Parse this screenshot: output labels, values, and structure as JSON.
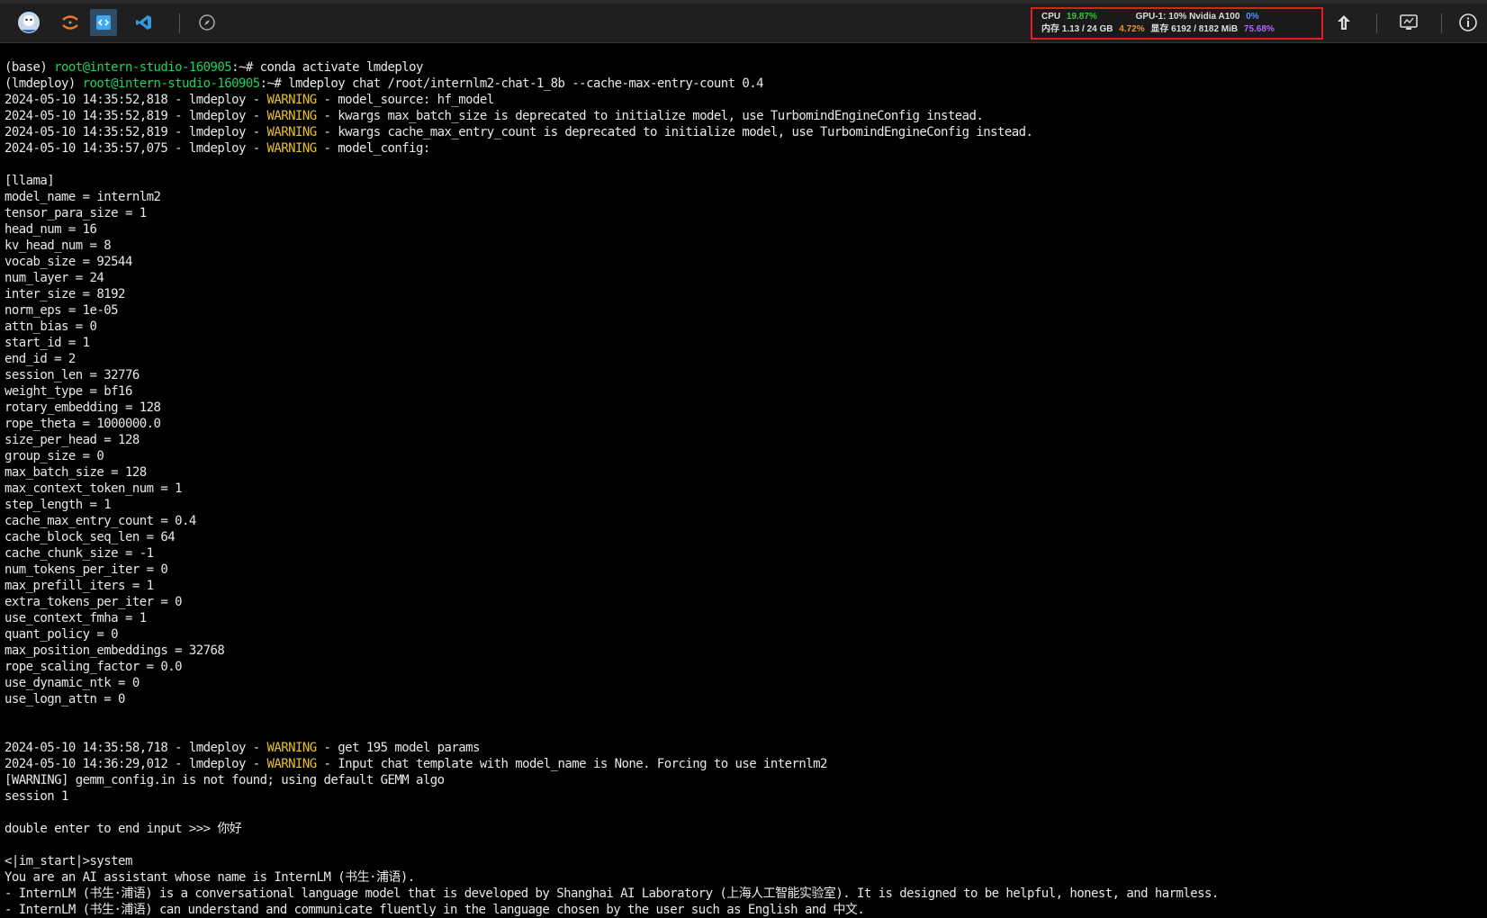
{
  "toolbar": {
    "icons": [
      "avatar-icon",
      "jupyter-icon",
      "code-editor-icon",
      "vscode-icon",
      "compass-icon",
      "upload-icon",
      "monitor-icon",
      "info-icon"
    ]
  },
  "monitor": {
    "cpu_label": "CPU",
    "cpu_value": "19.87%",
    "gpu_label": "GPU-1: 10% Nvidia A100",
    "gpu_value": "0%",
    "mem_label": "内存 1.13 / 24 GB",
    "mem_value": "4.72%",
    "vram_label": "显存 6192 / 8182 MiB",
    "vram_value": "75.68%",
    "colors": {
      "green": "#3fbf3f",
      "orange": "#e8962c",
      "blue": "#5a8cff",
      "purple": "#b067ff",
      "border": "#e0201c"
    }
  },
  "terminal": {
    "cmd1": {
      "prefix": "(base) ",
      "prompt": "root@intern-studio-160905",
      "sep": ":~# ",
      "command": "conda activate lmdeploy"
    },
    "cmd2": {
      "prefix": "(lmdeploy) ",
      "prompt": "root@intern-studio-160905",
      "sep": ":~# ",
      "command": "lmdeploy chat /root/internlm2-chat-1_8b --cache-max-entry-count 0.4"
    },
    "warn1": {
      "pre": "2024-05-10 14:35:52,818 - lmdeploy - ",
      "tag": "WARNING",
      "msg": " - model_source: hf_model"
    },
    "warn2": {
      "pre": "2024-05-10 14:35:52,819 - lmdeploy - ",
      "tag": "WARNING",
      "msg": " - kwargs max_batch_size is deprecated to initialize model, use TurbomindEngineConfig instead."
    },
    "warn3": {
      "pre": "2024-05-10 14:35:52,819 - lmdeploy - ",
      "tag": "WARNING",
      "msg": " - kwargs cache_max_entry_count is deprecated to initialize model, use TurbomindEngineConfig instead."
    },
    "warn4": {
      "pre": "2024-05-10 14:35:57,075 - lmdeploy - ",
      "tag": "WARNING",
      "msg": " - model_config:"
    },
    "section": "[llama]",
    "config": [
      "model_name = internlm2",
      "tensor_para_size = 1",
      "head_num = 16",
      "kv_head_num = 8",
      "vocab_size = 92544",
      "num_layer = 24",
      "inter_size = 8192",
      "norm_eps = 1e-05",
      "attn_bias = 0",
      "start_id = 1",
      "end_id = 2",
      "session_len = 32776",
      "weight_type = bf16",
      "rotary_embedding = 128",
      "rope_theta = 1000000.0",
      "size_per_head = 128",
      "group_size = 0",
      "max_batch_size = 128",
      "max_context_token_num = 1",
      "step_length = 1",
      "cache_max_entry_count = 0.4",
      "cache_block_seq_len = 64",
      "cache_chunk_size = -1",
      "num_tokens_per_iter = 0",
      "max_prefill_iters = 1",
      "extra_tokens_per_iter = 0",
      "use_context_fmha = 1",
      "quant_policy = 0",
      "max_position_embeddings = 32768",
      "rope_scaling_factor = 0.0",
      "use_dynamic_ntk = 0",
      "use_logn_attn = 0"
    ],
    "warn5": {
      "pre": "2024-05-10 14:35:58,718 - lmdeploy - ",
      "tag": "WARNING",
      "msg": " - get 195 model params"
    },
    "warn6": {
      "pre": "2024-05-10 14:36:29,012 - lmdeploy - ",
      "tag": "WARNING",
      "msg": " - Input chat template with model_name is None. Forcing to use internlm2"
    },
    "gemm_line": "[WARNING] gemm_config.in is not found; using default GEMM algo",
    "session_line": "session 1",
    "input_line": "double enter to end input >>> 你好",
    "im_start": "<|im_start|>system",
    "sys1": "You are an AI assistant whose name is InternLM (书生·浦语).",
    "sys2": "- InternLM (书生·浦语) is a conversational language model that is developed by Shanghai AI Laboratory (上海人工智能实验室). It is designed to be helpful, honest, and harmless.",
    "sys3": "- InternLM (书生·浦语) can understand and communicate fluently in the language chosen by the user such as English and 中文."
  }
}
